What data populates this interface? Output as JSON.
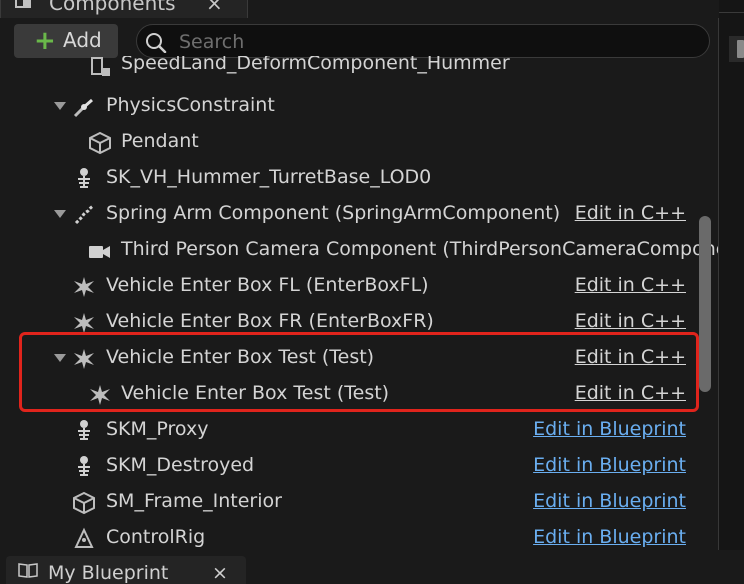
{
  "panel": {
    "title": "Components",
    "close_glyph": "×",
    "icon": "components-tab-icon"
  },
  "toolbar": {
    "add_plus": "+",
    "add_label": "Add",
    "search_placeholder": "Search",
    "search_value": ""
  },
  "tree": {
    "rows": [
      {
        "label": "SpeedLand_DeformComponent_Hummer",
        "icon": "static-mesh-icon",
        "edit": ""
      },
      {
        "label": "PhysicsConstraint",
        "icon": "physics-constraint-icon",
        "edit": ""
      },
      {
        "label": "Pendant",
        "icon": "cube-icon",
        "edit": ""
      },
      {
        "label": "SK_VH_Hummer_TurretBase_LOD0",
        "icon": "skeleton-icon",
        "edit": ""
      },
      {
        "label": "Spring Arm Component (SpringArmComponent)",
        "icon": "spring-arm-icon",
        "edit": "Edit in C++"
      },
      {
        "label": "Third Person Camera Component (ThirdPersonCameraComponer",
        "icon": "camera-icon",
        "edit": ""
      },
      {
        "label": "Vehicle Enter Box FL (EnterBoxFL)",
        "icon": "box-collision-icon",
        "edit": "Edit in C++"
      },
      {
        "label": "Vehicle Enter Box FR (EnterBoxFR)",
        "icon": "box-collision-icon",
        "edit": "Edit in C++"
      },
      {
        "label": "Vehicle Enter Box Test (Test)",
        "icon": "box-collision-icon",
        "edit": "Edit in C++"
      },
      {
        "label": "Vehicle Enter Box Test (Test)",
        "icon": "box-collision-icon",
        "edit": "Edit in C++"
      },
      {
        "label": "SKM_Proxy",
        "icon": "skeleton-icon",
        "edit": "Edit in Blueprint"
      },
      {
        "label": "SKM_Destroyed",
        "icon": "skeleton-icon",
        "edit": "Edit in Blueprint"
      },
      {
        "label": "SM_Frame_Interior",
        "icon": "cube-icon",
        "edit": "Edit in Blueprint"
      },
      {
        "label": "ControlRig",
        "icon": "control-rig-icon",
        "edit": "Edit in Blueprint"
      }
    ]
  },
  "bottom_tab": {
    "title": "My Blueprint",
    "close_glyph": "×",
    "icon": "book-icon"
  },
  "colors": {
    "highlight": "#e0241c",
    "blueprint_link": "#6aaef0",
    "add_plus": "#6ab84a"
  }
}
